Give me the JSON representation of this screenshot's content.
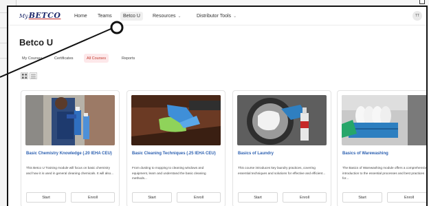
{
  "app": {
    "logo_prefix": "My",
    "logo_brand": "BETCO",
    "user_initials": "TT"
  },
  "nav": {
    "items": [
      {
        "label": "Home"
      },
      {
        "label": "Teams"
      },
      {
        "label": "Betco U",
        "active": true
      },
      {
        "label": "Resources",
        "has_dropdown": true
      },
      {
        "label": "Distributor Tools",
        "has_dropdown": true
      }
    ]
  },
  "page": {
    "title": "Betco U"
  },
  "tabs": [
    {
      "label": "My Courses"
    },
    {
      "label": "Certificates"
    },
    {
      "label": "All Courses",
      "active": true
    },
    {
      "label": "Reports"
    }
  ],
  "view_toggle": {
    "selected": "grid",
    "icons": [
      "grid-view-icon",
      "list-view-icon"
    ]
  },
  "courses": [
    {
      "title": "Basic Chemistry Knowledge (.20 IEHA CEU)",
      "description": "This Betco U Training module will focus on basic chemistry and how it is used in general cleaning chemicals. It will also...",
      "start_label": "Start",
      "enroll_label": "Enroll"
    },
    {
      "title": "Basic Cleaning Techniques (.25 IEHA CEU)",
      "description": "From dusting to mopping to cleaning windows and equipment, learn and understand the basic cleaning methods...",
      "start_label": "Start",
      "enroll_label": "Enroll"
    },
    {
      "title": "Basics of Laundry",
      "description": "This course introduces key laundry practices, covering essential techniques and solutions for effective and efficient...",
      "start_label": "Start",
      "enroll_label": "Enroll"
    },
    {
      "title": "Basics of Warewashing",
      "description": "The Basics of Warewashing module offers a comprehensive introduction to the essential processes and best practices for...",
      "start_label": "Start",
      "enroll_label": "Enroll"
    }
  ],
  "colors": {
    "brand_navy": "#1f2a6b",
    "brand_red": "#c62828",
    "link_blue": "#2b5fb0",
    "active_tab_bg": "#fde8ea"
  }
}
